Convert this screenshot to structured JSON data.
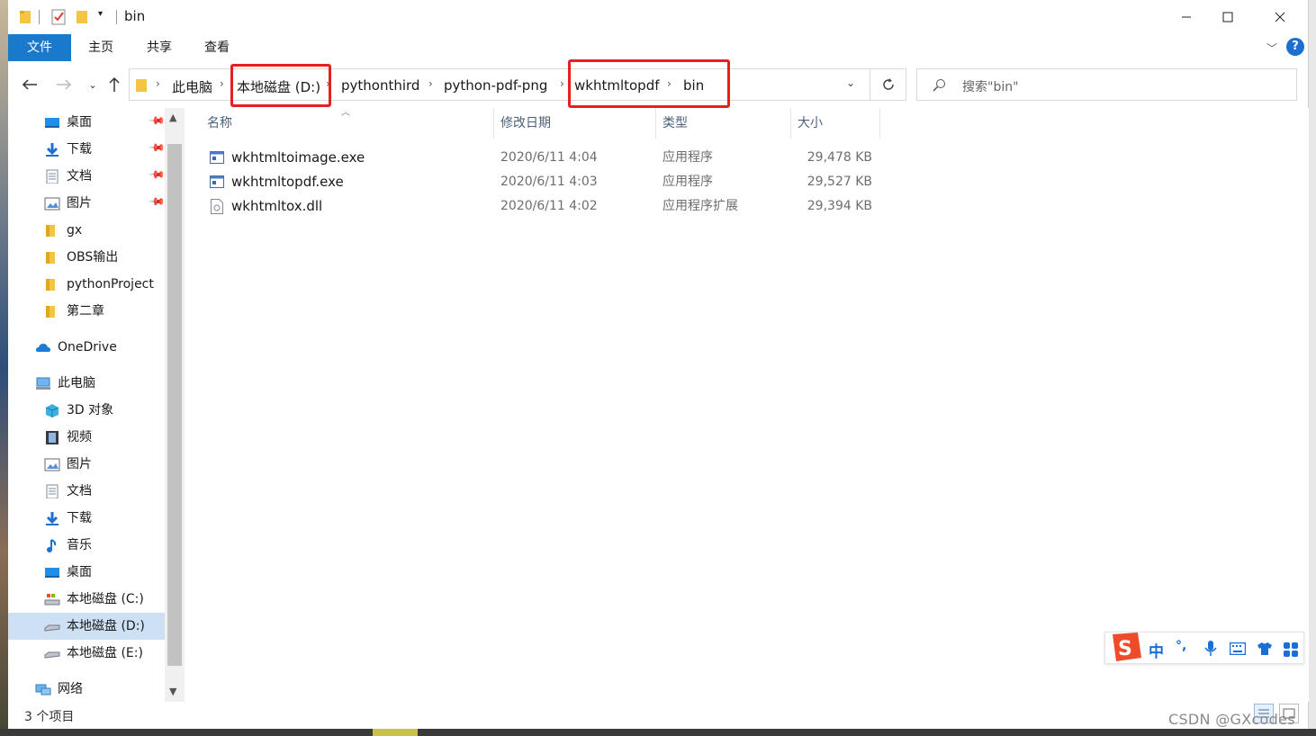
{
  "window": {
    "title": "bin"
  },
  "ribbon": {
    "tabs": [
      "文件",
      "主页",
      "共享",
      "查看"
    ]
  },
  "address": {
    "crumbs": [
      "此电脑",
      "本地磁盘 (D:)",
      "pythonthird",
      "python-pdf-png",
      "wkhtmltopdf",
      "bin"
    ],
    "search_placeholder": "搜索\"bin\""
  },
  "nav": {
    "quick_access": [
      {
        "label": "桌面",
        "icon": "desktop-icon",
        "pinned": true
      },
      {
        "label": "下载",
        "icon": "download-icon",
        "pinned": true
      },
      {
        "label": "文档",
        "icon": "documents-icon",
        "pinned": true
      },
      {
        "label": "图片",
        "icon": "pictures-icon",
        "pinned": true
      },
      {
        "label": "gx",
        "icon": "folder-icon"
      },
      {
        "label": "OBS输出",
        "icon": "folder-icon"
      },
      {
        "label": "pythonProject",
        "icon": "folder-icon"
      },
      {
        "label": "第二章",
        "icon": "folder-icon"
      }
    ],
    "onedrive": "OneDrive",
    "this_pc": "此电脑",
    "pc_items": [
      {
        "label": "3D 对象",
        "icon": "3d-objects-icon"
      },
      {
        "label": "视频",
        "icon": "videos-icon"
      },
      {
        "label": "图片",
        "icon": "pictures-icon"
      },
      {
        "label": "文档",
        "icon": "documents-icon"
      },
      {
        "label": "下载",
        "icon": "download-icon"
      },
      {
        "label": "音乐",
        "icon": "music-icon"
      },
      {
        "label": "桌面",
        "icon": "desktop-icon"
      },
      {
        "label": "本地磁盘 (C:)",
        "icon": "drive-c-icon"
      },
      {
        "label": "本地磁盘 (D:)",
        "icon": "drive-icon",
        "selected": true
      },
      {
        "label": "本地磁盘 (E:)",
        "icon": "drive-icon"
      }
    ],
    "network": "网络"
  },
  "columns": [
    "名称",
    "修改日期",
    "类型",
    "大小"
  ],
  "files": [
    {
      "name": "wkhtmltoimage.exe",
      "date": "2020/6/11 4:04",
      "type": "应用程序",
      "size": "29,478 KB",
      "icon": "exe-icon"
    },
    {
      "name": "wkhtmltopdf.exe",
      "date": "2020/6/11 4:03",
      "type": "应用程序",
      "size": "29,527 KB",
      "icon": "exe-icon"
    },
    {
      "name": "wkhtmltox.dll",
      "date": "2020/6/11 4:02",
      "type": "应用程序扩展",
      "size": "29,394 KB",
      "icon": "dll-icon"
    }
  ],
  "status": {
    "count": "3 个项目"
  },
  "ime": {
    "mode": "中",
    "punct": "°,"
  },
  "watermark": "CSDN @GXcodes",
  "colors": {
    "accent": "#1979ca",
    "highlight": "#e5201f",
    "selection": "#cde0f4"
  }
}
